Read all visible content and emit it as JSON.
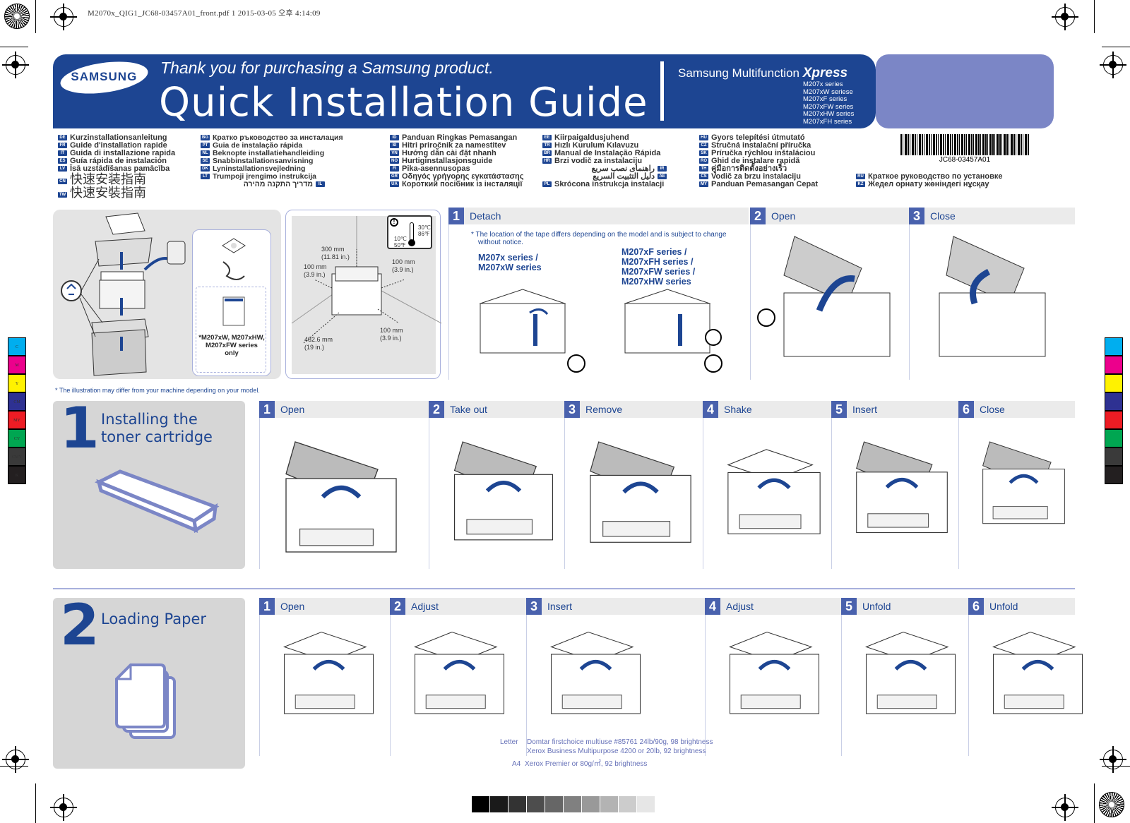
{
  "print_slug": "M2070x_QIG1_JC68-03457A01_front.pdf   1   2015-03-05   오후 4:14:09",
  "banner": {
    "brand": "SAMSUNG",
    "thanks": "Thank you for purchasing a Samsung product.",
    "title": "Quick Installation Guide",
    "product_line": "Samsung Multifunction",
    "product_brand": "Xpress",
    "series": [
      "M207x series",
      "M207xW seriese",
      "M207xF series",
      "M207xFW series",
      "M207xHW series",
      "M207xFH series"
    ]
  },
  "barcode_text": "JC68-03457A01",
  "languages": {
    "col1": [
      {
        "code": "DE",
        "text": "Kurzinstallationsanleitung"
      },
      {
        "code": "FR",
        "text": "Guide d'installation rapide"
      },
      {
        "code": "IT",
        "text": "Guida di installazione rapida"
      },
      {
        "code": "ES",
        "text": "Guía rápida de instalación"
      },
      {
        "code": "LV",
        "text": "Īsā uzstādīšanas pamācība"
      },
      {
        "code": "CN",
        "text": "快速安装指南"
      },
      {
        "code": "TW",
        "text": "快速安裝指南"
      }
    ],
    "col2": [
      {
        "code": "BG",
        "text": "Кратко ръководство за инсталация"
      },
      {
        "code": "PT",
        "text": "Guia de instalação rápida"
      },
      {
        "code": "NL",
        "text": "Beknopte installatiehandleiding"
      },
      {
        "code": "SE",
        "text": "Snabbinstallationsanvisning"
      },
      {
        "code": "DK",
        "text": "Lyninstallationsvejledning"
      },
      {
        "code": "LT",
        "text": "Trumpoji įrengimo instrukcija"
      },
      {
        "code": "IL",
        "text": "מדריך התקנה מהירה"
      }
    ],
    "col3": [
      {
        "code": "ID",
        "text": "Panduan Ringkas Pemasangan"
      },
      {
        "code": "SI",
        "text": "Hitri priročnik za namestitev"
      },
      {
        "code": "VN",
        "text": "Hướng dẫn cài đặt nhanh"
      },
      {
        "code": "NO",
        "text": "Hurtiginstallasjonsguide"
      },
      {
        "code": "FI",
        "text": "Pika-asennusopas"
      },
      {
        "code": "GR",
        "text": "Οδηγός γρήγορης εγκατάστασης"
      },
      {
        "code": "UA",
        "text": "Короткий посібник із інсталяції"
      }
    ],
    "col4": [
      {
        "code": "EE",
        "text": "Kiirpaigaldusjuhend"
      },
      {
        "code": "TR",
        "text": "Hızlı Kurulum Kılavuzu"
      },
      {
        "code": "BR",
        "text": "Manual de Instalação Rápida"
      },
      {
        "code": "HR",
        "text": "Brzi vodič za instalaciju"
      },
      {
        "code": "IR",
        "text": "راهنمای نصب سریع"
      },
      {
        "code": "AE",
        "text": "دليل التثبيت السريع"
      },
      {
        "code": "PL",
        "text": "Skrócona instrukcja instalacji"
      }
    ],
    "col5": [
      {
        "code": "HU",
        "text": "Gyors telepítési útmutató"
      },
      {
        "code": "CZ",
        "text": "Stručná instalační příručka"
      },
      {
        "code": "SK",
        "text": "Príručka rýchlou inštaláciou"
      },
      {
        "code": "RO",
        "text": "Ghid de instalare rapidă"
      },
      {
        "code": "TH",
        "text": "คู่มือการติดตั้งอย่างเร็ว"
      },
      {
        "code": "CS",
        "text": "Vodič za brzu instalaciju"
      },
      {
        "code": "MY",
        "text": "Panduan Pemasangan Cepat"
      }
    ],
    "col6": [
      {
        "code": "RU",
        "text": "Краткое руководство по установке"
      },
      {
        "code": "KZ",
        "text": "Жедел орнату жөніндегі нұсқау"
      }
    ]
  },
  "unpack": {
    "accessory_note": "*M207xW, M207xHW, M207xFW series only"
  },
  "placement": {
    "top": "300 mm",
    "top_in": "(11.81 in.)",
    "left": "100 mm",
    "left_in": "(3.9 in.)",
    "right": "100 mm",
    "right_in": "(3.9 in.)",
    "front": "482.6 mm",
    "front_in": "(19 in.)",
    "back": "100 mm",
    "back_in": "(3.9 in.)",
    "temp_high_c": "30℃",
    "temp_high_f": "86℉",
    "temp_low_c": "10℃",
    "temp_low_f": "50℉"
  },
  "illustration_note": "* The illustration may differ from your machine depending on your model.",
  "prep_steps": [
    {
      "num": "1",
      "label": "Detach"
    },
    {
      "num": "2",
      "label": "Open"
    },
    {
      "num": "3",
      "label": "Close"
    }
  ],
  "tape_note_1": "* The location of the tape differs depending on the model and is subject to change",
  "tape_note_2": "without notice.",
  "models_a": [
    "M207x series /",
    "M207xW series"
  ],
  "models_b": [
    "M207xF series /",
    "M207xFH series /",
    "M207xFW series /",
    "M207xHW series"
  ],
  "section1": {
    "num": "1",
    "title_1": "Installing the",
    "title_2": "toner cartridge",
    "steps": [
      {
        "num": "1",
        "label": "Open"
      },
      {
        "num": "2",
        "label": "Take out"
      },
      {
        "num": "3",
        "label": "Remove"
      },
      {
        "num": "4",
        "label": "Shake"
      },
      {
        "num": "5",
        "label": "Insert"
      },
      {
        "num": "6",
        "label": "Close"
      }
    ]
  },
  "section2": {
    "num": "2",
    "title": "Loading Paper",
    "steps": [
      {
        "num": "1",
        "label": "Open"
      },
      {
        "num": "2",
        "label": "Adjust"
      },
      {
        "num": "3",
        "label": "Insert"
      },
      {
        "num": "4",
        "label": "Adjust"
      },
      {
        "num": "5",
        "label": "Unfold"
      },
      {
        "num": "6",
        "label": "Unfold"
      }
    ]
  },
  "paper_spec": {
    "letter_label": "Letter",
    "letter_1": "Domtar firstchoice multiuse #85761 24lb/90g, 98 brightness",
    "letter_2": "Xerox Business Multipurpose 4200 or 20lb, 92 brightness",
    "a4_label": "A4",
    "a4_1": "Xerox Premier or 80g/㎡, 92 brightness"
  },
  "color_bar": {
    "labels": [
      "C",
      "M",
      "Y",
      "CM",
      "MY",
      "CY",
      "CMY",
      "K"
    ],
    "colors": [
      "#00aeef",
      "#ec008c",
      "#fff200",
      "#2e3192",
      "#ed1c24",
      "#00a651",
      "#3a3a3a",
      "#231f20"
    ]
  },
  "gray_bar": [
    "#000000",
    "#1a1a1a",
    "#333333",
    "#4d4d4d",
    "#666666",
    "#808080",
    "#999999",
    "#b3b3b3",
    "#cccccc",
    "#e6e6e6"
  ],
  "colors": {
    "brand_blue": "#1d4592",
    "accent_purple": "#7b86c6",
    "step_blue": "#4961ad"
  }
}
